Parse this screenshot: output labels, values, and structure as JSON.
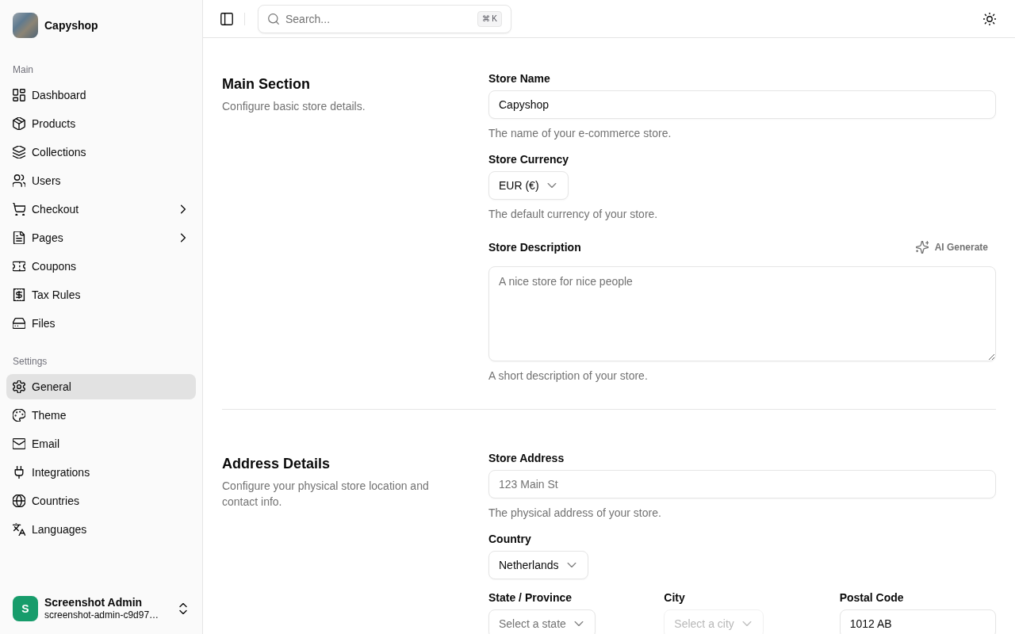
{
  "sidebar": {
    "brand": "Capyshop",
    "groups": [
      {
        "label": "Main",
        "items": [
          {
            "label": "Dashboard",
            "kind": "link",
            "selected": false
          },
          {
            "label": "Products",
            "kind": "link",
            "selected": false
          },
          {
            "label": "Collections",
            "kind": "link",
            "selected": false
          },
          {
            "label": "Users",
            "kind": "link",
            "selected": false
          },
          {
            "label": "Checkout",
            "kind": "submenu",
            "selected": false
          },
          {
            "label": "Pages",
            "kind": "submenu",
            "selected": false
          },
          {
            "label": "Coupons",
            "kind": "link",
            "selected": false
          },
          {
            "label": "Tax Rules",
            "kind": "link",
            "selected": false
          },
          {
            "label": "Files",
            "kind": "link",
            "selected": false
          }
        ]
      },
      {
        "label": "Settings",
        "items": [
          {
            "label": "General",
            "kind": "link",
            "selected": true
          },
          {
            "label": "Theme",
            "kind": "link",
            "selected": false
          },
          {
            "label": "Email",
            "kind": "link",
            "selected": false
          },
          {
            "label": "Integrations",
            "kind": "link",
            "selected": false
          },
          {
            "label": "Countries",
            "kind": "link",
            "selected": false
          },
          {
            "label": "Languages",
            "kind": "link",
            "selected": false
          }
        ]
      }
    ],
    "user": {
      "initial": "S",
      "name": "Screenshot Admin",
      "email": "screenshot-admin-c9d97…"
    }
  },
  "header": {
    "search": {
      "placeholder": "Search...",
      "shortcut": "⌘ K"
    }
  },
  "sections": [
    {
      "title": "Main Section",
      "description": "Configure basic store details.",
      "fields": [
        {
          "kind": "input",
          "label": "Store Name",
          "value": "Capyshop",
          "help": "The name of your e-commerce store.",
          "disabled": false
        },
        {
          "kind": "select",
          "label": "Store Currency",
          "value": "EUR (€)",
          "help": "The default currency of your store.",
          "disabled": false
        },
        {
          "kind": "textarea",
          "label": "Store Description",
          "action": "AI Generate",
          "placeholder": "A nice store for nice people",
          "help": "A short description of your store.",
          "disabled": false
        }
      ]
    },
    {
      "title": "Address Details",
      "description": "Configure your physical store location and contact info.",
      "fields": [
        {
          "kind": "input",
          "label": "Store Address",
          "placeholder": "123 Main St",
          "help": "The physical address of your store.",
          "disabled": false
        },
        {
          "kind": "select",
          "label": "Country",
          "value": "Netherlands",
          "disabled": false
        },
        {
          "kind": "row",
          "fields": [
            {
              "kind": "select",
              "label": "State / Province",
              "placeholder": "Select a state",
              "disabled": false
            },
            {
              "kind": "select",
              "label": "City",
              "placeholder": "Select a city",
              "disabled": true
            },
            {
              "kind": "input",
              "label": "Postal Code",
              "value": "1012 AB",
              "disabled": false
            }
          ]
        }
      ]
    }
  ]
}
